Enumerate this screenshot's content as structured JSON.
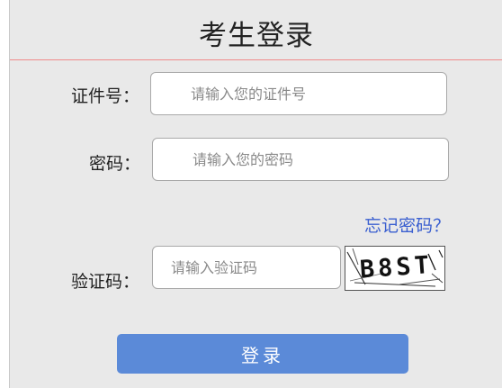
{
  "header": {
    "title": "考生登录"
  },
  "form": {
    "id_label": "证件号：",
    "id_placeholder": "请输入您的证件号",
    "password_label": "密码：",
    "password_placeholder": "请输入您的密码",
    "forgot_password": "忘记密码？",
    "captcha_label": "验证码：",
    "captcha_placeholder": "请输入验证码",
    "captcha_text": "B8ST",
    "login_label": "登录"
  },
  "colors": {
    "panel_bg": "#e9e9e9",
    "divider": "#f08b8b",
    "link": "#3a5fd0",
    "button": "#5b8ad8"
  }
}
